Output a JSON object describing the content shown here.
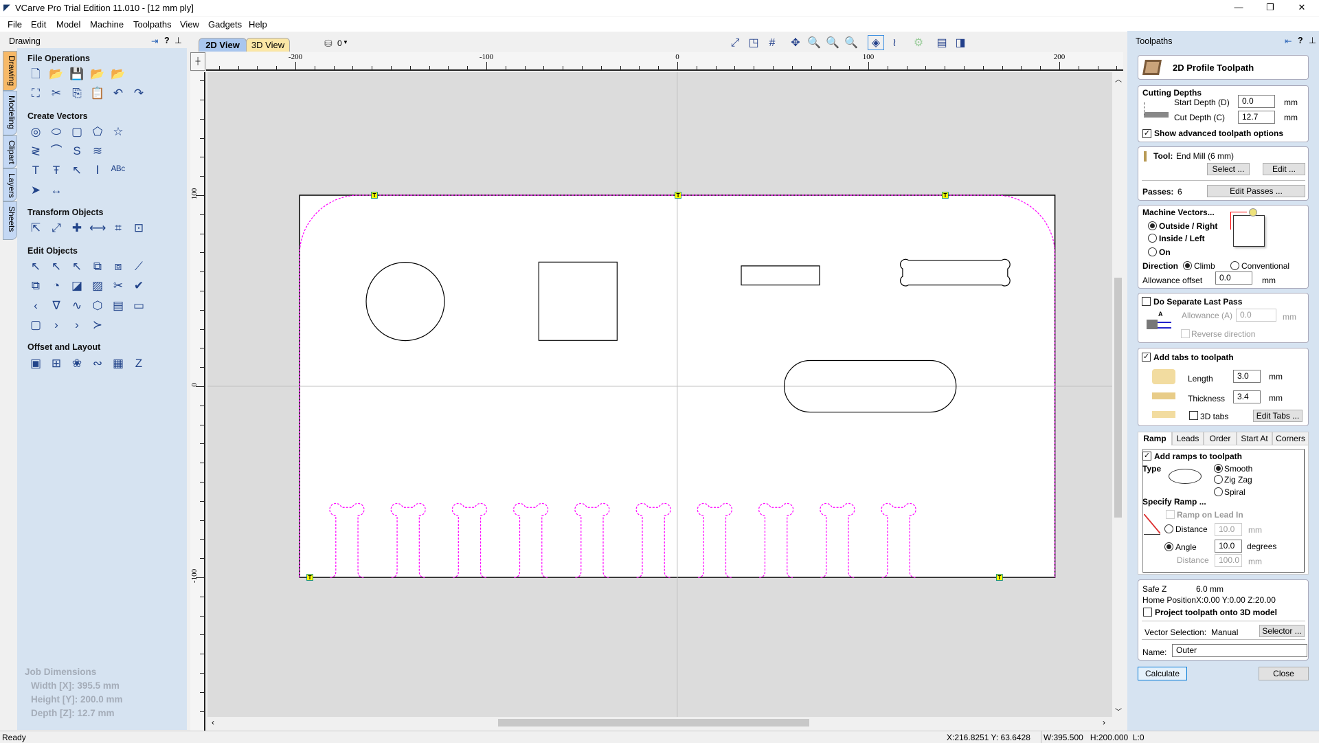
{
  "window": {
    "title": "VCarve Pro Trial Edition 11.010 - [12 mm ply]",
    "minimize": "—",
    "maximize": "❐",
    "close": "✕"
  },
  "menu": [
    "File",
    "Edit",
    "Model",
    "Machine",
    "Toolpaths",
    "View",
    "Gadgets",
    "Help"
  ],
  "left_panel": {
    "title": "Drawing",
    "side_tabs": [
      "Drawing",
      "Modeling",
      "Clipart",
      "Layers",
      "Sheets"
    ],
    "sections": [
      {
        "title": "File Operations",
        "rows": [
          [
            "new-file",
            "open-file",
            "save-file",
            "import-vectors",
            "import-bitmap"
          ],
          [
            "fit-view",
            "cut",
            "copy",
            "paste",
            "undo",
            "redo"
          ]
        ]
      },
      {
        "title": "Create Vectors",
        "rows": [
          [
            "draw-circle",
            "draw-ellipse",
            "draw-rectangle",
            "draw-polygon",
            "draw-star"
          ],
          [
            "draw-polyline",
            "draw-arc",
            "draw-curve",
            "draw-wave"
          ],
          [
            "draw-text",
            "auto-layout-text",
            "text-on-curve",
            "adjust-text",
            "arc-text"
          ],
          [
            "clipart-bird",
            "dimensions"
          ]
        ]
      },
      {
        "title": "Transform Objects",
        "rows": [
          [
            "move",
            "scale",
            "align",
            "mirror",
            "distort",
            "set-size"
          ]
        ]
      },
      {
        "title": "Edit Objects",
        "rows": [
          [
            "select",
            "node-edit",
            "transform-select",
            "group",
            "ungroup",
            "measure"
          ],
          [
            "weld",
            "subtract",
            "intersect",
            "hatch",
            "trim",
            "validate"
          ],
          [
            "fillet",
            "join-vectors",
            "smooth-curve",
            "curve-fit",
            "create-bitmap",
            "trace-bitmap"
          ],
          [
            "close-vectors",
            "dogbone",
            "chamfer",
            "extend"
          ]
        ]
      },
      {
        "title": "Offset and Layout",
        "rows": [
          [
            "offset",
            "array-copy",
            "circular-array",
            "nesting",
            "label",
            "zig-zag"
          ]
        ]
      }
    ],
    "job_dimensions": {
      "title": "Job Dimensions",
      "width": "Width  [X]: 395.5 mm",
      "height": "Height [Y]: 200.0 mm",
      "depth": "Depth  [Z]: 12.7 mm"
    }
  },
  "view_tabs": {
    "tab_2d": "2D View",
    "tab_3d": "3D View",
    "active": "2D View",
    "layer": "0"
  },
  "view_toolbar": [
    "zoom-extents",
    "zoom-material",
    "grid",
    "pan",
    "zoom-box",
    "zoom-in",
    "zoom-out",
    "toolpath-preview",
    "toolpath-show",
    "render-3d",
    "split-h",
    "split-v"
  ],
  "ruler": {
    "x_labels": [
      "-200",
      "-100",
      "0",
      "100",
      "200"
    ],
    "y_labels": [
      "100",
      "0",
      "-100"
    ]
  },
  "drawing": {
    "material_width_mm": 395.5,
    "material_height_mm": 200.0,
    "vector_color": "#000000",
    "toolpath_color": "#ff00ff",
    "tab_marker_color": "#ffff00",
    "tab_label": "T"
  },
  "right_panel": {
    "title": "Toolpaths",
    "toolpath_name": "2D Profile Toolpath",
    "cutting_depths": {
      "title": "Cutting Depths",
      "start_label": "Start Depth (D)",
      "start_value": "0.0",
      "cut_label": "Cut Depth (C)",
      "cut_value": "12.7",
      "unit": "mm",
      "show_advanced": "Show advanced toolpath options",
      "show_advanced_checked": true
    },
    "tool": {
      "label": "Tool:",
      "value": "End Mill (6 mm)",
      "select": "Select ...",
      "edit": "Edit ...",
      "passes_label": "Passes:",
      "passes_value": "6",
      "edit_passes": "Edit Passes ..."
    },
    "machine_vectors": {
      "title": "Machine Vectors...",
      "outside": "Outside / Right",
      "inside": "Inside / Left",
      "on": "On",
      "selected": "Outside / Right",
      "direction": "Direction",
      "climb": "Climb",
      "conventional": "Conventional",
      "direction_selected": "Climb",
      "allowance_label": "Allowance offset",
      "allowance_value": "0.0",
      "unit": "mm"
    },
    "last_pass": {
      "title": "Do Separate Last Pass",
      "checked": false,
      "allowance_label": "Allowance (A)",
      "allowance_value": "0.0",
      "unit": "mm",
      "reverse": "Reverse direction",
      "diagram_label": "A"
    },
    "tabs": {
      "title": "Add tabs to toolpath",
      "checked": true,
      "length_label": "Length",
      "length_value": "3.0",
      "thickness_label": "Thickness",
      "thickness_value": "3.4",
      "unit": "mm",
      "tabs3d": "3D tabs",
      "edit_tabs": "Edit Tabs ..."
    },
    "sub_tabs": [
      "Ramp",
      "Leads",
      "Order",
      "Start At",
      "Corners"
    ],
    "ramp": {
      "title": "Add ramps to toolpath",
      "checked": true,
      "type_label": "Type",
      "smooth": "Smooth",
      "zigzag": "Zig Zag",
      "spiral": "Spiral",
      "specify": "Specify Ramp ...",
      "lead_in": "Ramp on Lead In",
      "distance_label": "Distance",
      "distance_value": "10.0",
      "angle_label": "Angle",
      "angle_value": "10.0",
      "angle_unit": "degrees",
      "distance2_label": "Distance",
      "distance2_value": "100.0",
      "unit": "mm"
    },
    "misc": {
      "safe_z_label": "Safe Z",
      "safe_z_value": "6.0 mm",
      "home_label": "Home Position",
      "home_value": "X:0.00 Y:0.00 Z:20.00",
      "project": "Project toolpath onto 3D model",
      "vector_sel_label": "Vector Selection:",
      "vector_sel_value": "Manual",
      "selector": "Selector ...",
      "name_label": "Name:",
      "name_value": "Outer"
    },
    "calculate": "Calculate",
    "close": "Close"
  },
  "status": {
    "text": "Ready",
    "cursor": "X:216.8251 Y: 63.6428",
    "dims": "W:395.500   H:200.000  L:0"
  }
}
